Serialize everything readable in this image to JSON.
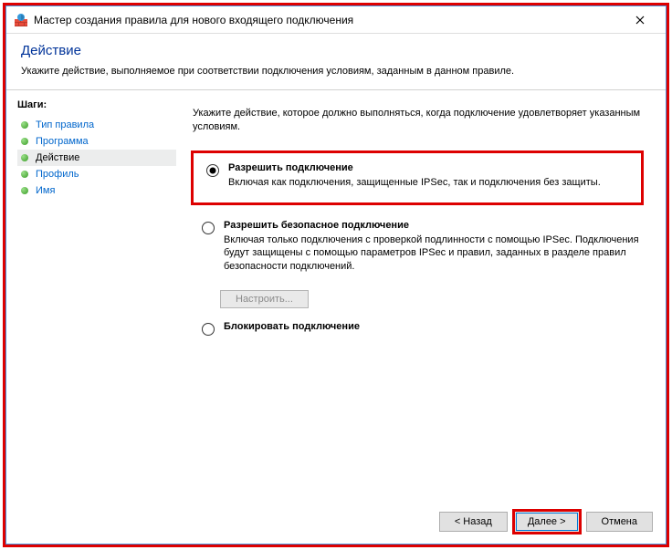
{
  "window": {
    "title": "Мастер создания правила для нового входящего подключения"
  },
  "header": {
    "title": "Действие",
    "subtitle": "Укажите действие, выполняемое при соответствии подключения условиям, заданным в данном правиле."
  },
  "sidebar": {
    "steps_label": "Шаги:",
    "steps": [
      {
        "label": "Тип правила"
      },
      {
        "label": "Программа"
      },
      {
        "label": "Действие"
      },
      {
        "label": "Профиль"
      },
      {
        "label": "Имя"
      }
    ]
  },
  "content": {
    "instruction": "Укажите действие, которое должно выполняться, когда подключение удовлетворяет указанным условиям.",
    "options": [
      {
        "title": "Разрешить подключение",
        "desc": "Включая как подключения, защищенные IPSec, так и подключения без защиты."
      },
      {
        "title": "Разрешить безопасное подключение",
        "desc": "Включая только подключения с проверкой подлинности с помощью IPSec. Подключения будут защищены с помощью параметров IPSec и правил, заданных в разделе правил безопасности подключений."
      },
      {
        "title": "Блокировать подключение",
        "desc": ""
      }
    ],
    "configure_btn": "Настроить..."
  },
  "footer": {
    "back": "< Назад",
    "next": "Далее >",
    "cancel": "Отмена"
  }
}
